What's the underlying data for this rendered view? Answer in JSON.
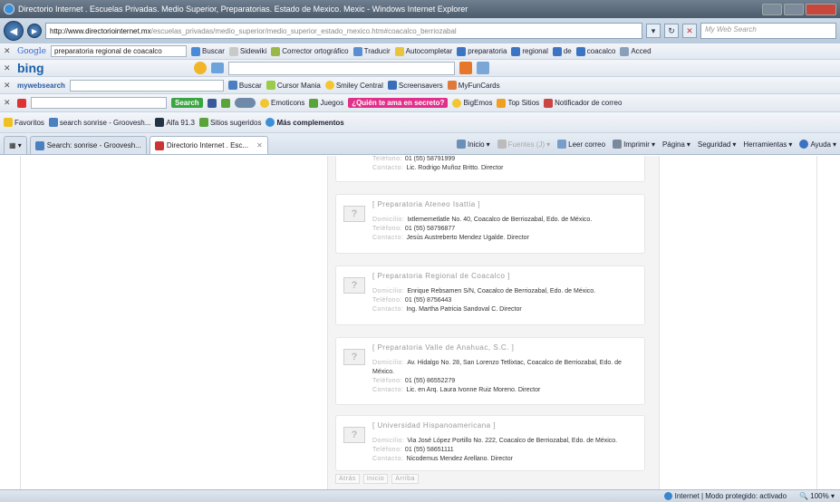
{
  "window": {
    "title": "Directorio Internet . Escuelas Privadas. Medio Superior, Preparatorias. Estado de Mexico. Mexic - Windows Internet Explorer"
  },
  "address": {
    "url_domain": "http://www.directoriointernet.mx",
    "url_path": "/escuelas_privadas/medio_superior/medio_superior_estado_mexico.htm#coacalco_berriozabal",
    "search_placeholder": "My Web Search"
  },
  "google_bar": {
    "brand": "Google",
    "query": "preparatoria regional de coacalco",
    "items": [
      "Buscar",
      "Sidewiki",
      "Corrector ortográfico",
      "Traducir",
      "Autocompletar",
      "preparatoria",
      "regional",
      "de",
      "coacalco"
    ],
    "trailing": "Acced"
  },
  "bing_bar": {
    "brand": "bing"
  },
  "mws_bar": {
    "brand": "mywebsearch",
    "items": [
      "Buscar",
      "Cursor Mania",
      "Smiley Central",
      "Screensavers",
      "MyFunCards"
    ]
  },
  "fun_bar": {
    "search_btn": "Search",
    "items": [
      "Emoticons",
      "Juegos",
      "¿Quién te ama en secreto?",
      "BigEmos",
      "Top Sitios",
      "Notificador de correo"
    ]
  },
  "favorites_bar": {
    "items": [
      "Favoritos",
      "search sonrise - Groovesh...",
      "Alfa 91.3",
      "Sitios sugeridos",
      "Más complementos"
    ]
  },
  "tabs": [
    {
      "label": "Search: sonrise - Groovesh..."
    },
    {
      "label": "Directorio Internet . Esc..."
    }
  ],
  "commands": [
    "Inicio",
    "Fuentes (J)",
    "Leer correo",
    "Imprimir",
    "Página",
    "Seguridad",
    "Herramientas",
    "Ayuda"
  ],
  "labels": {
    "domicilio": "Domicilio:",
    "telefono": "Teléfono:",
    "contacto": "Contacto:"
  },
  "top_fragment": {
    "telefono": "01 (55) 58791999",
    "contacto": "Lic. Rodrigo Muñoz Britto. Director"
  },
  "entries": [
    {
      "name": "[ Preparatoria Ateneo Isattia ]",
      "domicilio": "Ixtlememetlatle No. 40, Coacalco de Berriozabal, Edo. de México.",
      "telefono": "01 (55) 58796877",
      "contacto": "Jesús Austreberto Mendez Ugalde. Director"
    },
    {
      "name": "[ Preparatoria Regional de Coacalco ]",
      "domicilio": "Enrique Rebsamen S/N, Coacalco de Berriozabal, Edo. de México.",
      "telefono": "01 (55) 8756443",
      "contacto": "Ing. Martha Patricia Sandoval C. Director"
    },
    {
      "name": "[ Preparatoria Valle de Anahuac, S.C. ]",
      "domicilio": "Av. Hidalgo No. 28, San Lorenzo Tetlixtac, Coacalco de Berriozabal, Edo. de México.",
      "telefono": "01 (55) 86552279",
      "contacto": "Lic. en Arq. Laura Ivonne Ruiz Moreno. Director"
    },
    {
      "name": "[ Universidad Hispanoamericana ]",
      "domicilio": "Via José López Portillo No. 222, Coacalco de Berriozabal, Edo. de México.",
      "telefono": "01 (55) 58651111",
      "contacto": "Nicodemus Mendez Arellano. Director"
    }
  ],
  "pager": [
    "Atrás",
    "Inicio",
    "Arriba"
  ],
  "status": {
    "zone": "Internet | Modo protegido: activado",
    "zoom": "100%"
  },
  "colors": {
    "accent": "#1a5fa8",
    "pink": "#e0308a",
    "green": "#3aa540"
  }
}
